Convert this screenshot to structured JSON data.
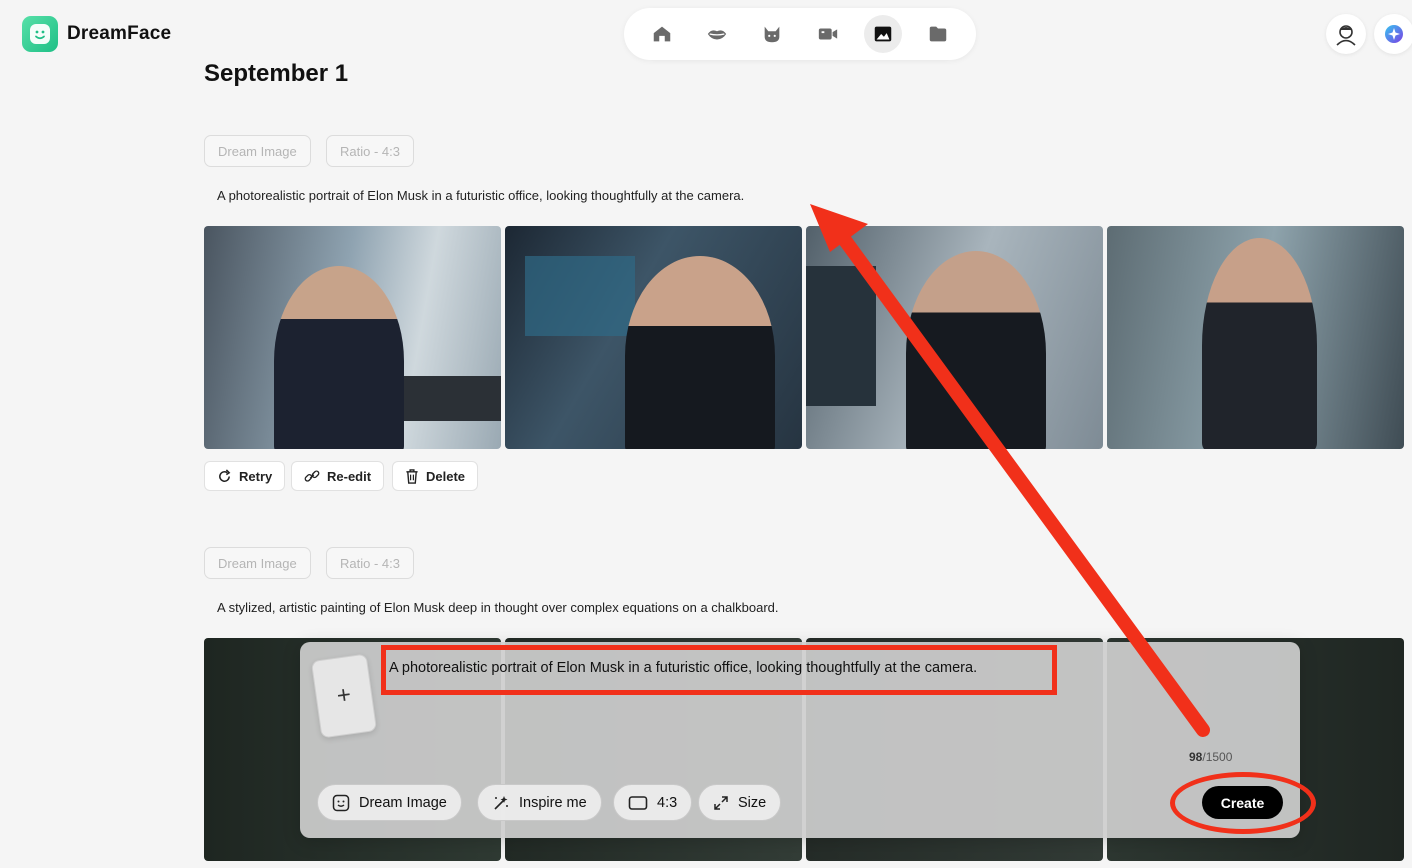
{
  "app": {
    "name": "DreamFace"
  },
  "nav": {
    "items": [
      {
        "icon": "home-icon"
      },
      {
        "icon": "lips-icon"
      },
      {
        "icon": "cat-icon"
      },
      {
        "icon": "video-camera-icon"
      },
      {
        "icon": "image-icon",
        "active": true
      },
      {
        "icon": "folder-icon"
      }
    ]
  },
  "history": {
    "date": "September 1",
    "entries": [
      {
        "tag_mode": "Dream Image",
        "tag_ratio": "Ratio - 4:3",
        "prompt": "A photorealistic portrait of Elon Musk in a futuristic office, looking thoughtfully at the camera.",
        "actions": {
          "retry": "Retry",
          "reedit": "Re-edit",
          "delete": "Delete"
        }
      },
      {
        "tag_mode": "Dream Image",
        "tag_ratio": "Ratio - 4:3",
        "prompt": "A stylized, artistic painting of Elon Musk deep in thought over complex equations on a chalkboard."
      }
    ]
  },
  "composer": {
    "prompt": "A photorealistic portrait of Elon Musk in a futuristic office, looking thoughtfully at the camera.",
    "count": "98",
    "max": "/1500",
    "upload_symbol": "+",
    "mode_label": "Dream Image",
    "inspire_label": "Inspire me",
    "ratio_label": "4:3",
    "size_label": "Size",
    "create_label": "Create"
  },
  "colors": {
    "accent": "#1fbf86",
    "annotation": "#f1301a",
    "create": "#000000"
  }
}
